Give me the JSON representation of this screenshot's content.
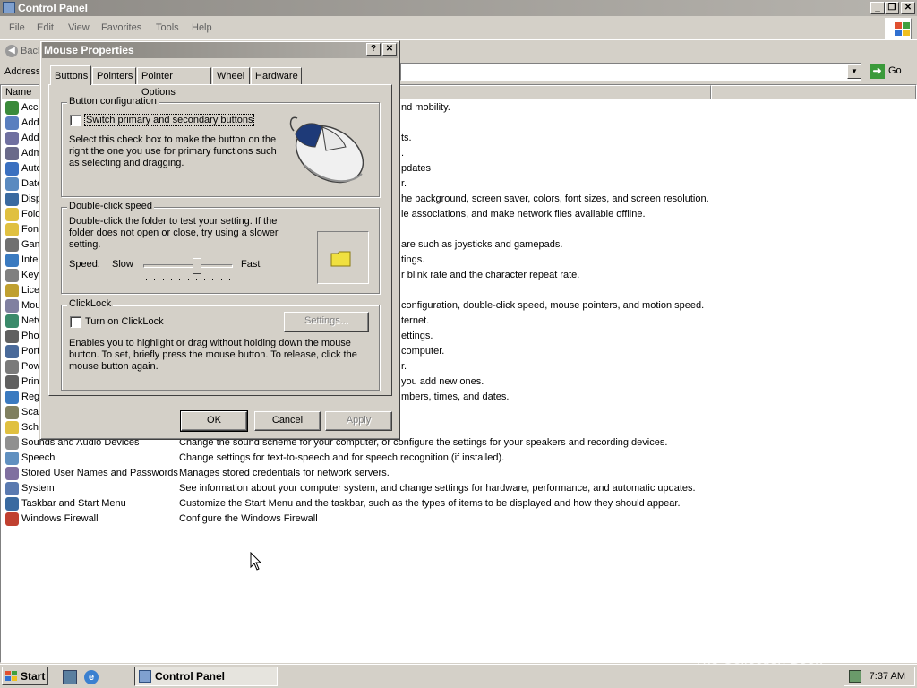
{
  "window": {
    "title": "Control Panel",
    "menu": [
      "File",
      "Edit",
      "View",
      "Favorites",
      "Tools",
      "Help"
    ],
    "toolbar_back": "Back",
    "address_label": "Address",
    "go_label": "Go",
    "columns": {
      "name": "Name"
    }
  },
  "rows": [
    {
      "name": "Acce",
      "desc": "nd mobility.",
      "icon_color": "#3a8a3a",
      "icon": "accessibility-icon"
    },
    {
      "name": "Add",
      "desc": "",
      "icon_color": "#5a7fbf",
      "icon": "add-hardware-icon"
    },
    {
      "name": "Add",
      "desc": "ts.",
      "icon_color": "#7070a0",
      "icon": "add-programs-icon"
    },
    {
      "name": "Adm",
      "desc": ".",
      "icon_color": "#6a6a8a",
      "icon": "admin-tools-icon"
    },
    {
      "name": "Auto",
      "desc": "pdates",
      "icon_color": "#3a70c0",
      "icon": "automatic-updates-icon"
    },
    {
      "name": "Date",
      "desc": "r.",
      "icon_color": "#5a8ac0",
      "icon": "date-time-icon"
    },
    {
      "name": "Disp",
      "desc": "he background, screen saver, colors, font sizes, and screen resolution.",
      "icon_color": "#3a6aa0",
      "icon": "display-icon"
    },
    {
      "name": "Fold",
      "desc": "le associations, and make network files available offline.",
      "icon_color": "#e0c040",
      "icon": "folder-options-icon"
    },
    {
      "name": "Font",
      "desc": "",
      "icon_color": "#e0c040",
      "icon": "fonts-icon"
    },
    {
      "name": "Gam",
      "desc": "are such as joysticks and gamepads.",
      "icon_color": "#707070",
      "icon": "game-controllers-icon"
    },
    {
      "name": "Inte",
      "desc": "tings.",
      "icon_color": "#3a7ac0",
      "icon": "internet-options-icon"
    },
    {
      "name": "Keyb",
      "desc": "r blink rate and the character repeat rate.",
      "icon_color": "#808080",
      "icon": "keyboard-icon"
    },
    {
      "name": "Licer",
      "desc": "",
      "icon_color": "#c0a030",
      "icon": "licensing-icon"
    },
    {
      "name": "Mou",
      "desc": "configuration, double-click speed, mouse pointers, and motion speed.",
      "icon_color": "#8080a0",
      "icon": "mouse-icon"
    },
    {
      "name": "Netv",
      "desc": "ternet.",
      "icon_color": "#3a8a6a",
      "icon": "network-icon"
    },
    {
      "name": "Phor",
      "desc": "ettings.",
      "icon_color": "#606060",
      "icon": "phone-modem-icon"
    },
    {
      "name": "Port",
      "desc": "computer.",
      "icon_color": "#4a6a9a",
      "icon": "portable-media-icon"
    },
    {
      "name": "Pow",
      "desc": "r.",
      "icon_color": "#7a7a7a",
      "icon": "power-options-icon"
    },
    {
      "name": "Print",
      "desc": "you add new ones.",
      "icon_color": "#606060",
      "icon": "printers-icon"
    },
    {
      "name": "Regi",
      "desc": "mbers, times, and dates.",
      "icon_color": "#3a7ac0",
      "icon": "regional-options-icon"
    },
    {
      "name": "Scar",
      "desc": "",
      "icon_color": "#808060",
      "icon": "scanners-icon"
    },
    {
      "name": "Sche",
      "desc": "",
      "icon_color": "#e0c040",
      "icon": "scheduled-tasks-icon"
    },
    {
      "name": "Sounds and Audio Devices",
      "desc": "Change the sound scheme for your computer, or configure the settings for your speakers and recording devices.",
      "icon_color": "#909090",
      "icon": "sounds-icon"
    },
    {
      "name": "Speech",
      "desc": "Change settings for text-to-speech and for speech recognition (if installed).",
      "icon_color": "#6090c0",
      "icon": "speech-icon"
    },
    {
      "name": "Stored User Names and Passwords",
      "desc": "Manages stored credentials for network servers.",
      "icon_color": "#8070a0",
      "icon": "stored-passwords-icon"
    },
    {
      "name": "System",
      "desc": "See information about your computer system, and change settings for hardware, performance, and automatic updates.",
      "icon_color": "#5a7ab0",
      "icon": "system-icon"
    },
    {
      "name": "Taskbar and Start Menu",
      "desc": "Customize the Start Menu and the taskbar, such as the types of items to be displayed and how they should appear.",
      "icon_color": "#3a6aa0",
      "icon": "taskbar-icon"
    },
    {
      "name": "Windows Firewall",
      "desc": "Configure the Windows Firewall",
      "icon_color": "#c04030",
      "icon": "firewall-icon"
    }
  ],
  "dialog": {
    "title": "Mouse Properties",
    "help_btn": "?",
    "close_btn": "✕",
    "tabs": [
      "Buttons",
      "Pointers",
      "Pointer Options",
      "Wheel",
      "Hardware"
    ],
    "button_config": {
      "legend": "Button configuration",
      "checkbox_label": "Switch primary and secondary buttons",
      "text": [
        "Select this check box to make the button on the",
        "right the one you use for primary functions such",
        "as selecting and dragging."
      ]
    },
    "dblclick": {
      "legend": "Double-click speed",
      "text": [
        "Double-click the folder to test your setting. If the",
        "folder does not open or close, try using a slower",
        "setting."
      ],
      "speed_label": "Speed:",
      "slow": "Slow",
      "fast": "Fast",
      "slider_value": 0.6
    },
    "clicklock": {
      "legend": "ClickLock",
      "checkbox_label": "Turn on ClickLock",
      "settings_btn": "Settings...",
      "text": [
        "Enables you to highlight or drag without holding down the mouse",
        "button. To set, briefly press the mouse button. To release, click the",
        "mouse button again."
      ]
    },
    "ok": "OK",
    "cancel": "Cancel",
    "apply": "Apply"
  },
  "taskbar": {
    "start": "Start",
    "task": "Control Panel",
    "clock": "7:37 AM"
  },
  "watermark": "The Collection Book"
}
